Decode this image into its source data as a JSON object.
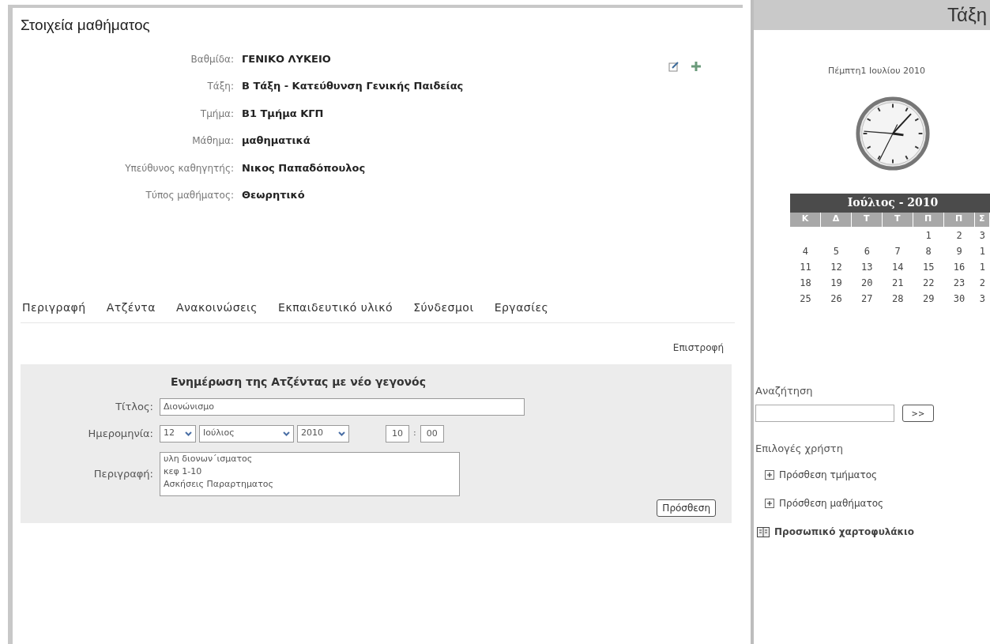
{
  "course_panel": {
    "title": "Στοιχεία μαθήματος",
    "fields": [
      {
        "label": "Βαθμίδα:",
        "value": "ΓΕΝΙΚΟ ΛΥΚΕΙΟ"
      },
      {
        "label": "Τάξη:",
        "value": "Β Τάξη - Κατεύθυνση Γενικής Παιδείας"
      },
      {
        "label": "Τμήμα:",
        "value": "Β1 Τμήμα ΚΓΠ"
      },
      {
        "label": "Μάθημα:",
        "value": "μαθηματικά"
      },
      {
        "label": "Υπεύθυνος καθηγητής:",
        "value": "Νικος Παπαδόπουλος"
      },
      {
        "label": "Τύπος μαθήματος:",
        "value": "Θεωρητικό"
      }
    ],
    "tabs": [
      "Περιγραφή",
      "Ατζέντα",
      "Ανακοινώσεις",
      "Εκπαιδευτικό υλικό",
      "Σύνδεσμοι",
      "Εργασίες"
    ],
    "back_link": "Επιστροφή",
    "form": {
      "heading": "Ενημέρωση της Ατζέντας με νέο γεγονός",
      "title_label": "Τίτλος:",
      "title_value": "Διονώνισμο",
      "date_label": "Ημερομηνία:",
      "day": "12",
      "month": "Ιούλιος",
      "year": "2010",
      "hour": "10",
      "time_separator": ":",
      "minute": "00",
      "description_label": "Περιγραφή:",
      "description_value": "υλη διονων΄ισματος\nκεφ 1-10\nΑσκήσεις Παραρτηματος",
      "submit": "Πρόσθεση"
    }
  },
  "sidebar": {
    "header": "Τάξη",
    "date": "Πέμπτη1 Ιουλίου 2010",
    "calendar": {
      "title": "Ιούλιος - 2010",
      "weekdays": [
        "Κ",
        "Δ",
        "Τ",
        "Τ",
        "Π",
        "Π",
        "Σ"
      ],
      "weeks": [
        [
          "1",
          "2",
          "3"
        ],
        [
          "4",
          "5",
          "6",
          "7",
          "8",
          "9",
          "1"
        ],
        [
          "11",
          "12",
          "13",
          "14",
          "15",
          "16",
          "1"
        ],
        [
          "18",
          "19",
          "20",
          "21",
          "22",
          "23",
          "2"
        ],
        [
          "25",
          "26",
          "27",
          "28",
          "29",
          "30",
          "3"
        ]
      ]
    },
    "search_label": "Αναζήτηση",
    "search_button": ">>",
    "options_label": "Επιλογές χρήστη",
    "options": [
      {
        "kind": "add",
        "label": "Πρόσθεση τμήματος"
      },
      {
        "kind": "add",
        "label": "Πρόσθεση μαθήματος"
      },
      {
        "kind": "folder",
        "label": "Προσωπικό χαρτοφυλάκιο"
      }
    ]
  }
}
